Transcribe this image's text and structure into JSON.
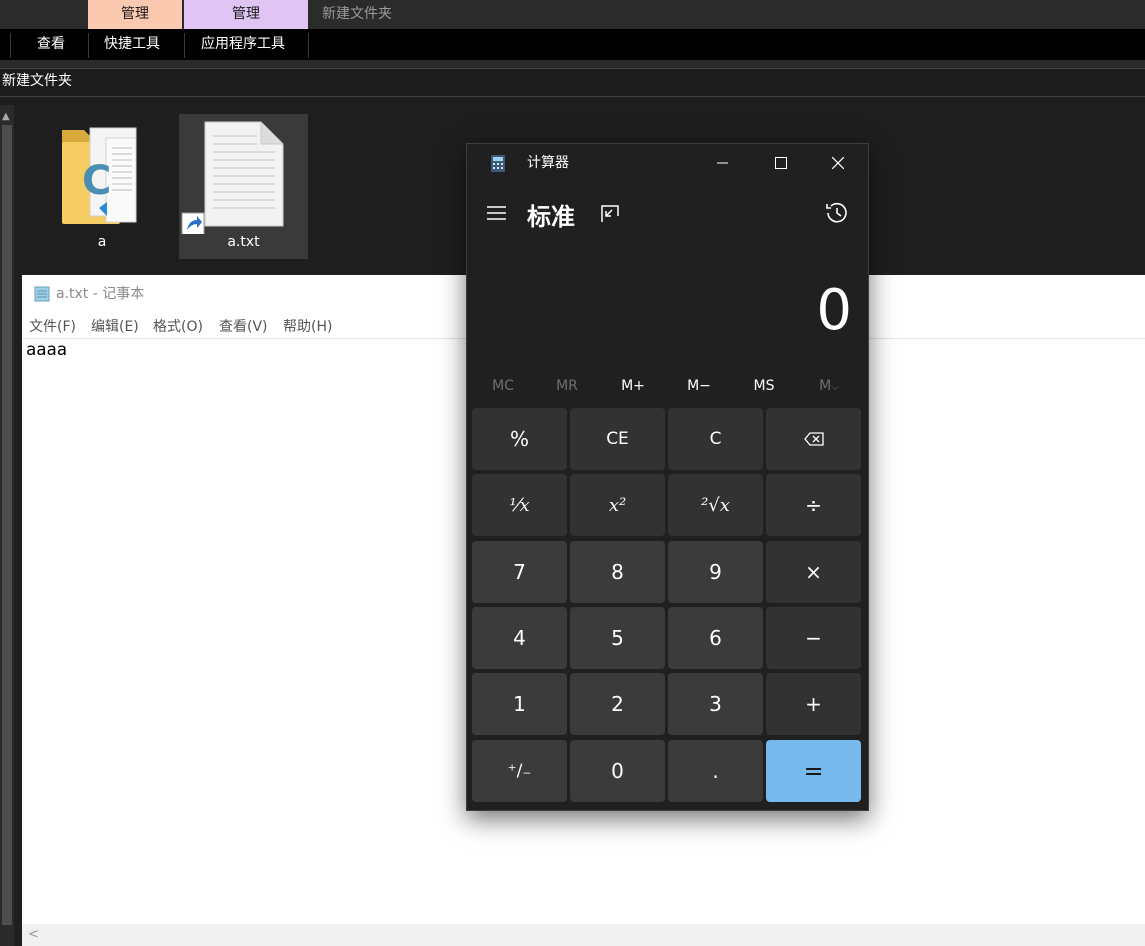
{
  "explorer": {
    "context_tabs": [
      "管理",
      "管理"
    ],
    "folder_title": "新建文件夹",
    "ribbon": [
      {
        "label": "查看"
      },
      {
        "label": "快捷工具"
      },
      {
        "label": "应用程序工具"
      }
    ],
    "address": "新建文件夹",
    "files": [
      {
        "name": "a",
        "icon": "folder-vscode-icon"
      },
      {
        "name": "a.txt",
        "icon": "text-file-shortcut-icon"
      }
    ]
  },
  "notepad": {
    "title": "a.txt - 记事本",
    "menus": [
      "文件(F)",
      "编辑(E)",
      "格式(O)",
      "查看(V)",
      "帮助(H)"
    ],
    "content": "aaaa"
  },
  "calculator": {
    "title": "计算器",
    "mode": "标准",
    "display": "0",
    "memory": [
      {
        "label": "MC",
        "enabled": false
      },
      {
        "label": "MR",
        "enabled": false
      },
      {
        "label": "M+",
        "enabled": true
      },
      {
        "label": "M−",
        "enabled": true
      },
      {
        "label": "MS",
        "enabled": true
      },
      {
        "label": "M",
        "enabled": false
      }
    ],
    "keys": {
      "percent": "%",
      "ce": "CE",
      "c": "C",
      "reciprocal": "⅟x",
      "square": "x²",
      "sqrt": "²√x",
      "divide": "÷",
      "seven": "7",
      "eight": "8",
      "nine": "9",
      "multiply": "×",
      "four": "4",
      "five": "5",
      "six": "6",
      "minus": "−",
      "one": "1",
      "two": "2",
      "three": "3",
      "plus": "+",
      "negate": "⁺∕₋",
      "zero": "0",
      "decimal": ".",
      "equals": "="
    },
    "colors": {
      "equals_bg": "#76b9ed",
      "window_bg": "#202020"
    }
  }
}
